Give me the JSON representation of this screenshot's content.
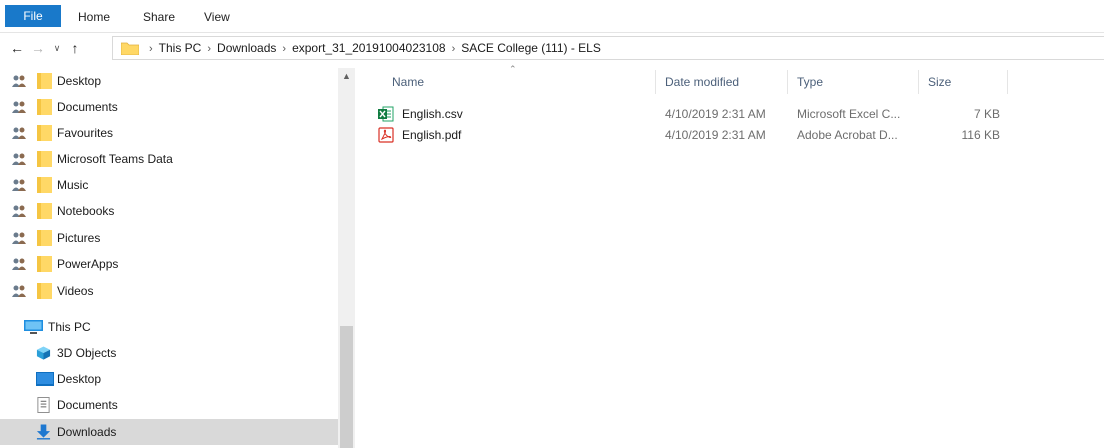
{
  "ribbon": {
    "tabs": [
      "File",
      "Home",
      "Share",
      "View"
    ]
  },
  "address": {
    "crumbs": [
      "This PC",
      "Downloads",
      "export_31_20191004023108",
      "SACE College (111) - ELS"
    ]
  },
  "nav": {
    "quick_access": [
      {
        "label": "Desktop"
      },
      {
        "label": "Documents"
      },
      {
        "label": "Favourites"
      },
      {
        "label": "Microsoft Teams Data"
      },
      {
        "label": "Music"
      },
      {
        "label": "Notebooks"
      },
      {
        "label": "Pictures"
      },
      {
        "label": "PowerApps"
      },
      {
        "label": "Videos"
      }
    ],
    "this_pc": {
      "label": "This PC",
      "children": [
        {
          "label": "3D Objects",
          "icon": "3d-objects-icon"
        },
        {
          "label": "Desktop",
          "icon": "desktop-icon"
        },
        {
          "label": "Documents",
          "icon": "documents-icon"
        },
        {
          "label": "Downloads",
          "icon": "downloads-icon"
        }
      ]
    }
  },
  "content": {
    "columns": [
      "Name",
      "Date modified",
      "Type",
      "Size"
    ],
    "rows": [
      {
        "name": "English.csv",
        "date": "4/10/2019 2:31 AM",
        "type": "Microsoft Excel C...",
        "size": "7 KB",
        "icon": "excel-file-icon"
      },
      {
        "name": "English.pdf",
        "date": "4/10/2019 2:31 AM",
        "type": "Adobe Acrobat D...",
        "size": "116 KB",
        "icon": "pdf-file-icon"
      }
    ]
  },
  "colors": {
    "file_tab": "#1979ca",
    "folder": "#ffd866",
    "selected": "#d9d9d9"
  }
}
